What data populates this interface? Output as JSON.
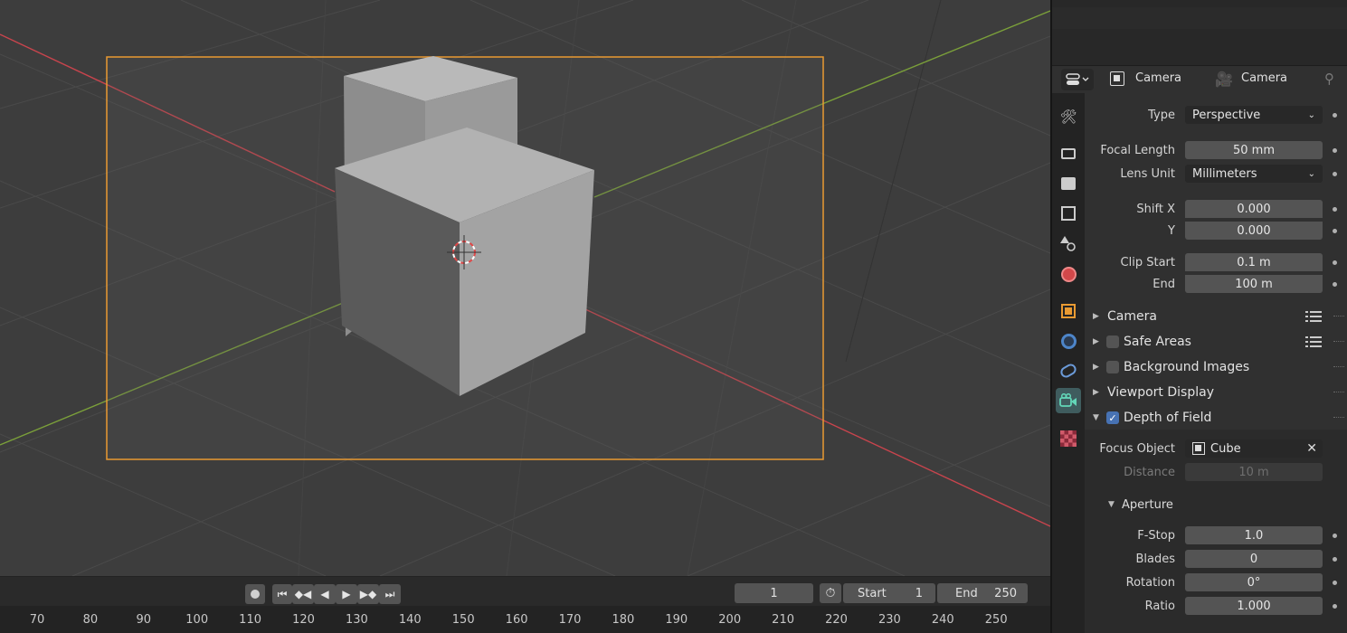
{
  "colors": {
    "x_axis": "#c8444d",
    "y_axis": "#7ba03a",
    "camera_frame": "#e99a32",
    "active_tab": "#3f5c5e",
    "checkbox_on": "#4772b3"
  },
  "header": {
    "editor_type_icon": "properties-editor-icon",
    "object_name": "Camera",
    "data_name": "Camera"
  },
  "tabs": [
    {
      "name": "tool",
      "icon": "wrench-screwdriver-icon"
    },
    {
      "name": "render",
      "icon": "render-camera-icon"
    },
    {
      "name": "output",
      "icon": "printer-icon"
    },
    {
      "name": "view-layer",
      "icon": "image-stack-icon"
    },
    {
      "name": "scene",
      "icon": "scene-shapes-icon"
    },
    {
      "name": "world",
      "icon": "globe-icon"
    },
    {
      "name": "object",
      "icon": "orange-square-icon"
    },
    {
      "name": "physics",
      "icon": "blue-circle-icon"
    },
    {
      "name": "constraints",
      "icon": "wrench-link-icon"
    },
    {
      "name": "camera-data",
      "icon": "video-camera-icon",
      "active": true
    },
    {
      "name": "texture",
      "icon": "checker-icon"
    }
  ],
  "props": {
    "type_label": "Type",
    "type_value": "Perspective",
    "focal_length_label": "Focal Length",
    "focal_length_value": "50 mm",
    "lens_unit_label": "Lens Unit",
    "lens_unit_value": "Millimeters",
    "shift_x_label": "Shift X",
    "shift_x_value": "0.000",
    "shift_y_label": "Y",
    "shift_y_value": "0.000",
    "clip_start_label": "Clip Start",
    "clip_start_value": "0.1 m",
    "clip_end_label": "End",
    "clip_end_value": "100 m",
    "panels": {
      "camera": "Camera",
      "safe_areas": "Safe Areas",
      "background_images": "Background Images",
      "viewport_display": "Viewport Display",
      "depth_of_field": "Depth of Field",
      "aperture": "Aperture"
    },
    "safe_areas_checked": false,
    "background_images_checked": false,
    "dof_checked": true,
    "focus_object_label": "Focus Object",
    "focus_object_value": "Cube",
    "distance_label": "Distance",
    "distance_value": "10 m",
    "fstop_label": "F-Stop",
    "fstop_value": "1.0",
    "blades_label": "Blades",
    "blades_value": "0",
    "rotation_label": "Rotation",
    "rotation_value": "0°",
    "ratio_label": "Ratio",
    "ratio_value": "1.000"
  },
  "timeline": {
    "current_frame": "1",
    "start_label": "Start",
    "start_value": "1",
    "end_label": "End",
    "end_value": "250",
    "ruler_ticks": [
      "70",
      "80",
      "90",
      "100",
      "110",
      "120",
      "130",
      "140",
      "150",
      "160",
      "170",
      "180",
      "190",
      "200",
      "210",
      "220",
      "230",
      "240",
      "250"
    ]
  }
}
